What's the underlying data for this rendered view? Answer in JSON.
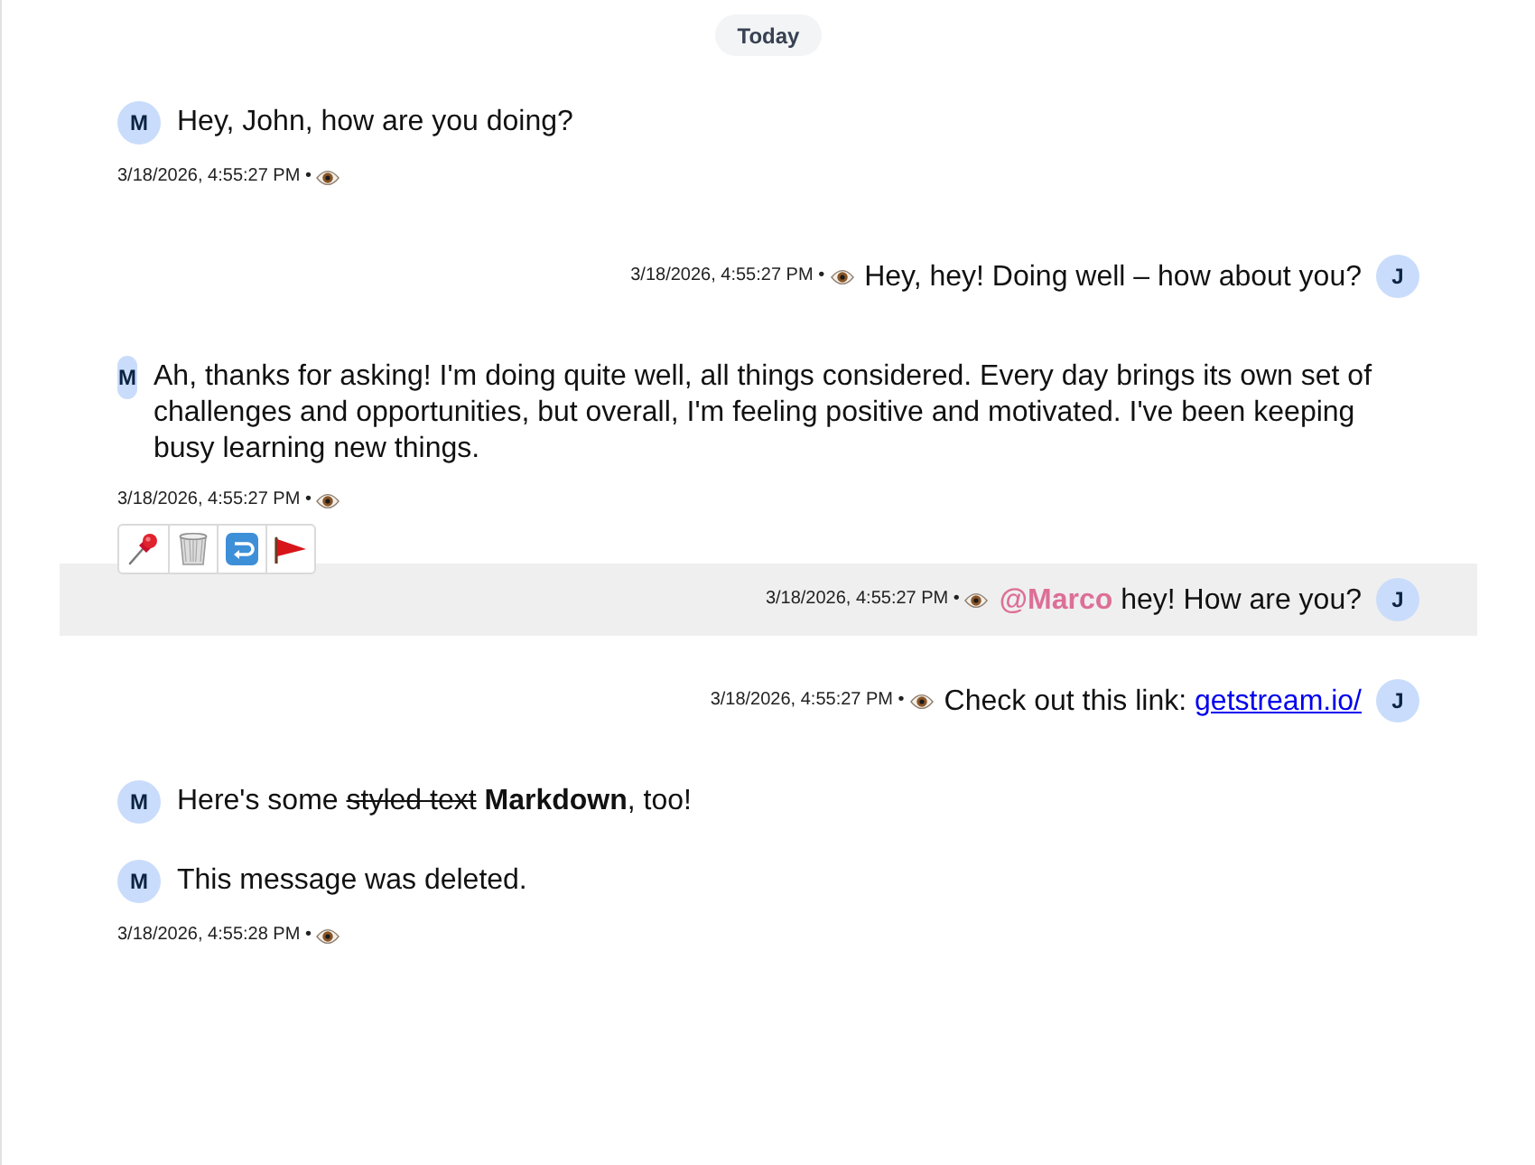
{
  "date_separator": "Today",
  "messages": [
    {
      "sender": "M",
      "mine": false,
      "highlighted": false,
      "parts": [
        {
          "kind": "text",
          "text": "Hey, John, how are you doing?"
        }
      ],
      "time": "3/18/2026, 4:55:27 PM •",
      "seen": true
    },
    {
      "sender": "J",
      "mine": true,
      "highlighted": false,
      "parts": [
        {
          "kind": "text",
          "text": "Hey, hey! Doing well – how about you?"
        }
      ],
      "time": "3/18/2026, 4:55:27 PM •",
      "seen": true
    },
    {
      "sender": "M",
      "mine": false,
      "highlighted": false,
      "parts": [
        {
          "kind": "text",
          "text": "Ah, thanks for asking! I'm doing quite well, all things considered. Every day brings its own set of challenges and opportunities, but overall, I'm feeling positive and motivated. I've been keeping busy learning new things."
        }
      ],
      "time": "3/18/2026, 4:55:27 PM •",
      "seen": true,
      "actions": [
        {
          "kind": "pin"
        },
        {
          "kind": "trash"
        },
        {
          "kind": "return"
        },
        {
          "kind": "flag"
        }
      ]
    },
    {
      "sender": "J",
      "mine": true,
      "highlighted": true,
      "parts": [
        {
          "kind": "mention",
          "text": "@Marco"
        },
        {
          "kind": "text",
          "text": " hey! How are you?"
        }
      ],
      "time": "3/18/2026, 4:55:27 PM •",
      "seen": true
    },
    {
      "sender": "J",
      "mine": true,
      "highlighted": false,
      "parts": [
        {
          "kind": "text",
          "text": "Check out this link: "
        },
        {
          "kind": "link",
          "text": "getstream.io/"
        }
      ],
      "time": "3/18/2026, 4:55:27 PM •",
      "seen": true
    },
    {
      "sender": "M",
      "mine": false,
      "highlighted": false,
      "parts": [
        {
          "kind": "text",
          "text": "Here's some "
        },
        {
          "kind": "strike",
          "text": "styled text"
        },
        {
          "kind": "text",
          "text": " **Markdown**, too!"
        }
      ]
    },
    {
      "sender": "M",
      "mine": false,
      "highlighted": false,
      "parts": [
        {
          "kind": "text",
          "text": "This message was deleted."
        }
      ],
      "time": "3/18/2026, 4:55:28 PM •",
      "seen": true
    }
  ]
}
